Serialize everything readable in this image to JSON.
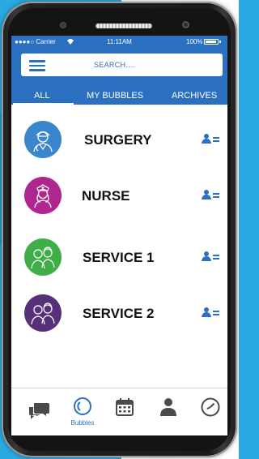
{
  "statusbar": {
    "carrier": "●●●●○ Carrier",
    "wifi_icon": "wifi-icon",
    "time": "11:11AM",
    "battery": "100%"
  },
  "search": {
    "placeholder": "SEARCH...."
  },
  "tabs": [
    {
      "label": "ALL",
      "active": true
    },
    {
      "label": "MY BUBBLES",
      "active": false
    },
    {
      "label": "ARCHIVES",
      "active": false
    }
  ],
  "bubbles": [
    {
      "label": "SURGERY",
      "color": "#3a86cc",
      "icon": "surgeon-icon"
    },
    {
      "label": "NURSE",
      "color": "#b0268f",
      "icon": "nurse-icon"
    },
    {
      "label": "SERVICE 1",
      "color": "#3fae49",
      "icon": "staff-pair-icon"
    },
    {
      "label": "SERVICE 2",
      "color": "#57307a",
      "icon": "staff-pair-icon"
    }
  ],
  "bottom_nav": [
    {
      "icon": "chat-icon",
      "label": ""
    },
    {
      "icon": "bubbles-icon",
      "label": "Bubbles",
      "active": true
    },
    {
      "icon": "calendar-icon",
      "label": ""
    },
    {
      "icon": "profile-icon",
      "label": ""
    },
    {
      "icon": "clock-icon",
      "label": ""
    }
  ],
  "colors": {
    "header_blue": "#2a6fc0",
    "background_blue": "#29a9e0",
    "nav_icon": "#4a4a4a",
    "active_nav": "#2a6fc0"
  }
}
